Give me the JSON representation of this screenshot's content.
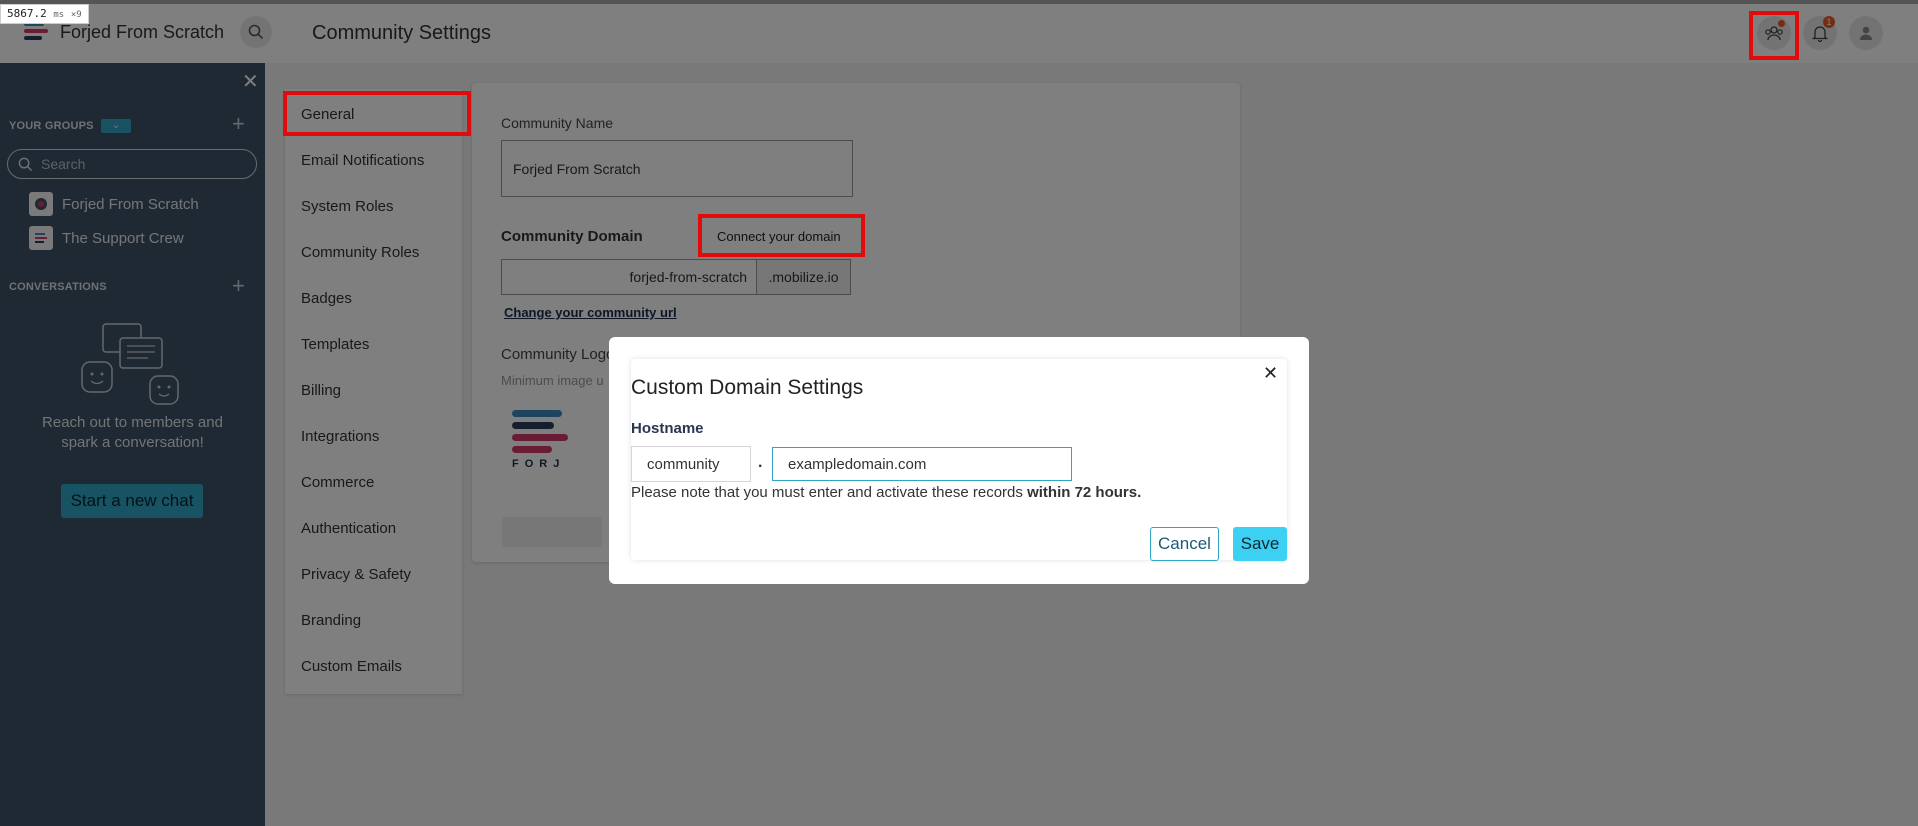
{
  "perf": {
    "time": "5867.2",
    "unit": "ms",
    "suffix": "×9"
  },
  "header": {
    "community_name": "Forjed From Scratch",
    "page_title": "Community Settings",
    "notification_count": "1"
  },
  "sidebar": {
    "groups_heading": "YOUR GROUPS",
    "search_placeholder": "Search",
    "groups": [
      {
        "label": "Forjed From Scratch"
      },
      {
        "label": "The Support Crew"
      }
    ],
    "conversations_heading": "CONVERSATIONS",
    "empty_message": "Reach out to members and spark a conversation!",
    "start_chat_label": "Start a new chat"
  },
  "settings_nav": {
    "items": [
      {
        "label": "General"
      },
      {
        "label": "Email Notifications"
      },
      {
        "label": "System Roles"
      },
      {
        "label": "Community Roles"
      },
      {
        "label": "Badges"
      },
      {
        "label": "Templates"
      },
      {
        "label": "Billing"
      },
      {
        "label": "Integrations"
      },
      {
        "label": "Commerce"
      },
      {
        "label": "Authentication"
      },
      {
        "label": "Privacy & Safety"
      },
      {
        "label": "Branding"
      },
      {
        "label": "Custom Emails"
      }
    ]
  },
  "general": {
    "community_name_label": "Community Name",
    "community_name_value": "Forjed From Scratch",
    "domain_label": "Community Domain",
    "connect_domain_label": "Connect your domain",
    "subdomain_value": "forjed-from-scratch",
    "domain_suffix": ".mobilize.io",
    "change_url_label": "Change your community url",
    "logo_label": "Community Logo",
    "logo_hint": "Minimum image u",
    "logo_text": "FORJ"
  },
  "modal": {
    "title": "Custom Domain Settings",
    "hostname_label": "Hostname",
    "subdomain_value": "community",
    "separator": ".",
    "domain_value": "exampledomain.com",
    "note_prefix": "Please note that you must enter and activate these records ",
    "note_bold": "within 72 hours.",
    "cancel_label": "Cancel",
    "save_label": "Save"
  },
  "colors": {
    "accent": "#2fa6c5",
    "save": "#3cd1f2",
    "sidebar_bg": "#3e5266",
    "highlight": "#e10b0b",
    "notification": "#e35d2a"
  }
}
